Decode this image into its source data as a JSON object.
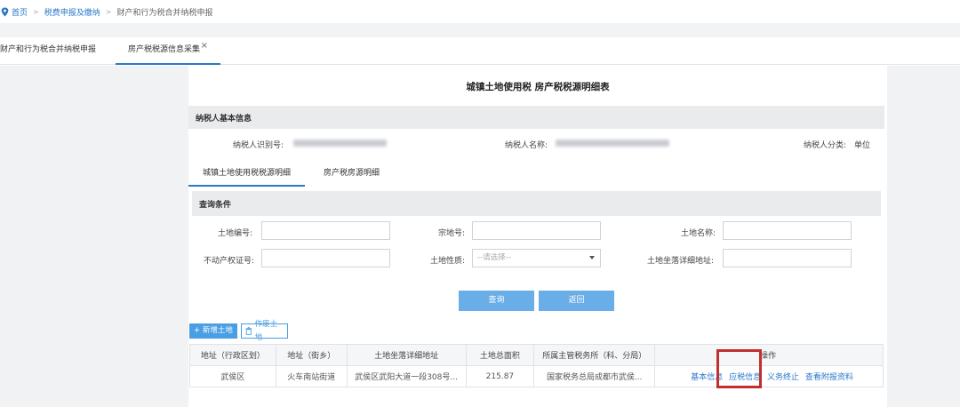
{
  "breadcrumb": {
    "home": "首页",
    "level1": "税费申报及缴纳",
    "level2": "财产和行为税合并纳税申报",
    "separator": ">"
  },
  "tabs": [
    {
      "label": "财产和行为税合并纳税申报"
    },
    {
      "label": "房产税税源信息采集",
      "close": "×"
    }
  ],
  "doc_title": "城镇土地使用税 房产税税源明细表",
  "taxpayer": {
    "section_title": "纳税人基本信息",
    "id_label": "纳税人识别号:",
    "id_value": "",
    "name_label": "纳税人名称:",
    "name_value": "",
    "type_label": "纳税人分类:",
    "type_value": "单位"
  },
  "subtabs": [
    {
      "label": "城镇土地使用税税源明细"
    },
    {
      "label": "房产税房源明细"
    }
  ],
  "query": {
    "section_title": "查询条件",
    "land_no_label": "土地编号:",
    "parcel_no_label": "宗地号:",
    "land_name_label": "土地名称:",
    "cert_no_label": "不动产权证号:",
    "land_nature_label": "土地性质:",
    "land_nature_placeholder": "--请选择--",
    "address_label": "土地坐落详细地址:",
    "search_label": "查询",
    "back_label": "返回"
  },
  "actions": {
    "add_label": "+ 新增土地",
    "void_label": "作废土地"
  },
  "table": {
    "headers": [
      "地址（行政区划）",
      "地址（街乡）",
      "土地坐落详细地址",
      "土地总面积",
      "所属主管税务所（科、分局）",
      "操作"
    ],
    "rows": [
      {
        "district": "武侯区",
        "street": "火车南站街道",
        "address": "武侯区武阳大道一段308号...",
        "area": "215.87",
        "tax_office": "国家税务总局成都市武侯...",
        "ops": [
          "基本信息",
          "应税信息",
          "义务终止",
          "查看附报资料"
        ]
      }
    ]
  },
  "colors": {
    "accent": "#2a78c8",
    "button": "#6aaee8",
    "highlight": "#c0302e"
  }
}
